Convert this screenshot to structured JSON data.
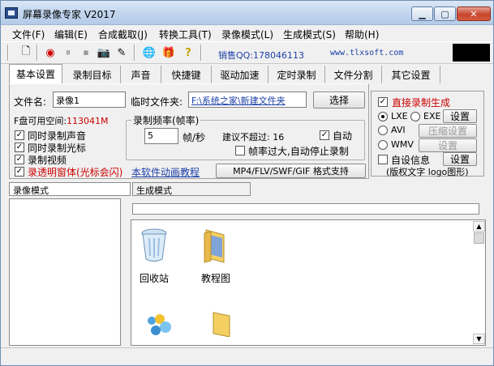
{
  "window": {
    "title": "屏幕录像专家 V2017"
  },
  "menu": [
    "文件(F)",
    "编辑(E)",
    "合成截取(J)",
    "转换工具(T)",
    "录像模式(L)",
    "生成模式(S)",
    "帮助(H)"
  ],
  "toolbar": {
    "qq": "销售QQ:178046113",
    "site": "www.tlxsoft.com"
  },
  "tabs": [
    "基本设置",
    "录制目标",
    "声音",
    "快捷键",
    "驱动加速",
    "定时录制",
    "文件分割",
    "其它设置"
  ],
  "basic": {
    "filename_label": "文件名:",
    "filename_value": "录像1",
    "tempdir_label": "临时文件夹:",
    "tempdir_value": "F:\\系统之家\\新建文件夹",
    "select_btn": "选择",
    "disk_label": "F盘可用空间:",
    "disk_value": "113041M",
    "opt_audio": "同时录制声音",
    "opt_cursor": "同时录制光标",
    "opt_video": "录制视频",
    "opt_transparent": "录透明窗体(光标会闪)",
    "anim_link": "本软件动画教程",
    "format_btn": "MP4/FLV/SWF/GIF  格式支持",
    "freq_group": "录制频率(帧率)",
    "fps_value": "5",
    "fps_unit": "帧/秒",
    "suggest": "建议不超过: 16",
    "auto": "自动",
    "auto_stop": "帧率过大,自动停止录制"
  },
  "right": {
    "direct": "直接录制生成",
    "lxe": "LXE",
    "exe": "EXE",
    "avi": "AVI",
    "wmv": "WMV",
    "set1": "设置",
    "compress": "压缩设置",
    "set2": "设置",
    "custom": "自设信息",
    "set3": "设置",
    "copyright": "(版权文字 logo图形)"
  },
  "mode": {
    "record": "录像模式",
    "generate": "生成模式"
  },
  "explorer": {
    "recycle": "回收站",
    "tutorial": "教程图"
  }
}
